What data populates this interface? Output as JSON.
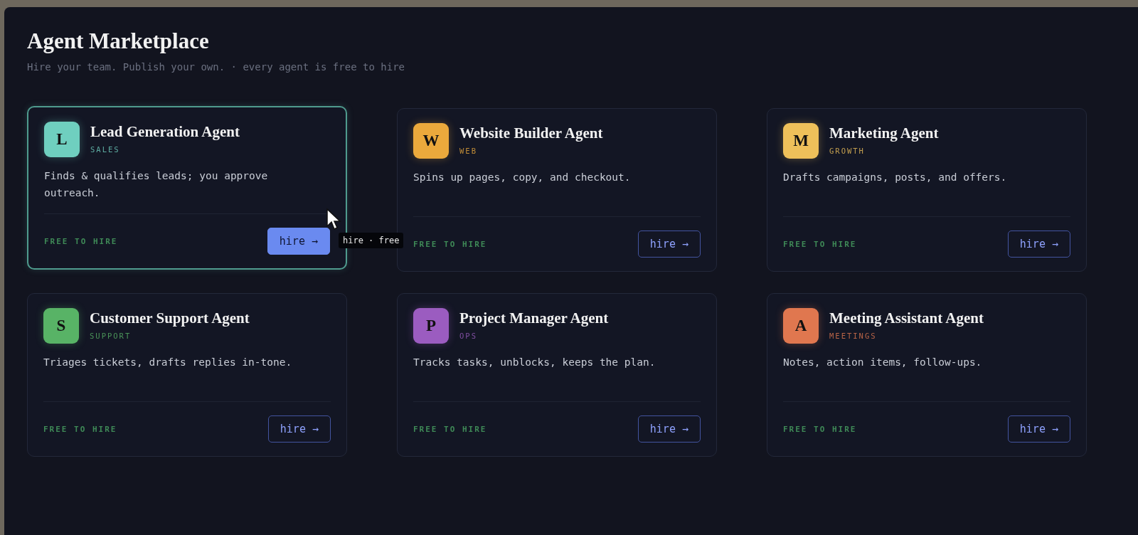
{
  "header": {
    "title": "Agent Marketplace",
    "subtitle": "Hire your team. Publish your own. · every agent is free to hire"
  },
  "agents": [
    {
      "letter": "L",
      "name": "Lead Generation Agent",
      "category": "SALES",
      "color": "#6fcfbf",
      "description": "Finds & qualifies leads; you approve outreach.",
      "availability": "FREE TO HIRE",
      "button": "hire →",
      "selected": true
    },
    {
      "letter": "W",
      "name": "Website Builder Agent",
      "category": "WEB",
      "color": "#eba93c",
      "description": "Spins up pages, copy, and checkout.",
      "availability": "FREE TO HIRE",
      "button": "hire →",
      "selected": false
    },
    {
      "letter": "M",
      "name": "Marketing Agent",
      "category": "GROWTH",
      "color": "#eec05a",
      "description": "Drafts campaigns, posts, and offers.",
      "availability": "FREE TO HIRE",
      "button": "hire →",
      "selected": false
    },
    {
      "letter": "S",
      "name": "Customer Support Agent",
      "category": "SUPPORT",
      "color": "#58b366",
      "description": "Triages tickets, drafts replies in-tone.",
      "availability": "FREE TO HIRE",
      "button": "hire →",
      "selected": false
    },
    {
      "letter": "P",
      "name": "Project Manager Agent",
      "category": "OPS",
      "color": "#9b5cc0",
      "description": "Tracks tasks, unblocks, keeps the plan.",
      "availability": "FREE TO HIRE",
      "button": "hire →",
      "selected": false
    },
    {
      "letter": "A",
      "name": "Meeting Assistant Agent",
      "category": "MEETINGS",
      "color": "#e0774f",
      "description": "Notes, action items, follow-ups.",
      "availability": "FREE TO HIRE",
      "button": "hire →",
      "selected": false
    }
  ],
  "tooltip": {
    "text": "hire · free"
  }
}
